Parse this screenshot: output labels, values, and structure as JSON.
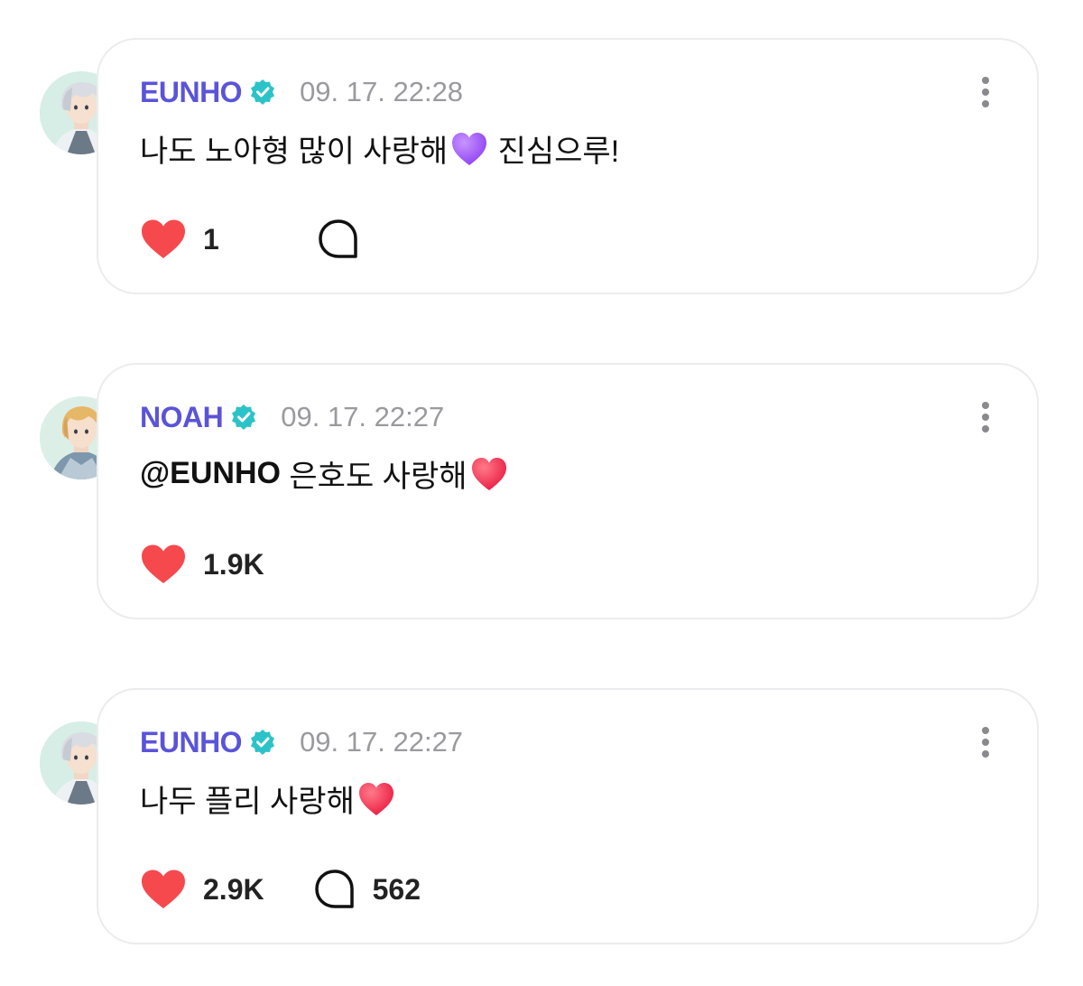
{
  "colors": {
    "username": "#5a54d9",
    "verified_badge": "#2cc3c8",
    "heart": "#f5494e",
    "timestamp": "#9a9a9e",
    "card_border": "#ececee"
  },
  "comments": [
    {
      "username": "EUNHO",
      "verified": true,
      "timestamp": "09. 17. 22:28",
      "message_text": "나도 노아형 많이 사랑해",
      "message_emoji": "purple-heart",
      "message_suffix": " 진심으루!",
      "like_count": "1",
      "comment_count": ""
    },
    {
      "username": "NOAH",
      "verified": true,
      "timestamp": "09. 17. 22:27",
      "mention": "@EUNHO",
      "message_text": " 은호도 사랑해",
      "message_emoji": "red-heart",
      "like_count": "1.9K"
    },
    {
      "username": "EUNHO",
      "verified": true,
      "timestamp": "09. 17. 22:27",
      "message_text": "나두 플리 사랑해",
      "message_emoji": "red-heart",
      "like_count": "2.9K",
      "comment_count": "562"
    }
  ]
}
